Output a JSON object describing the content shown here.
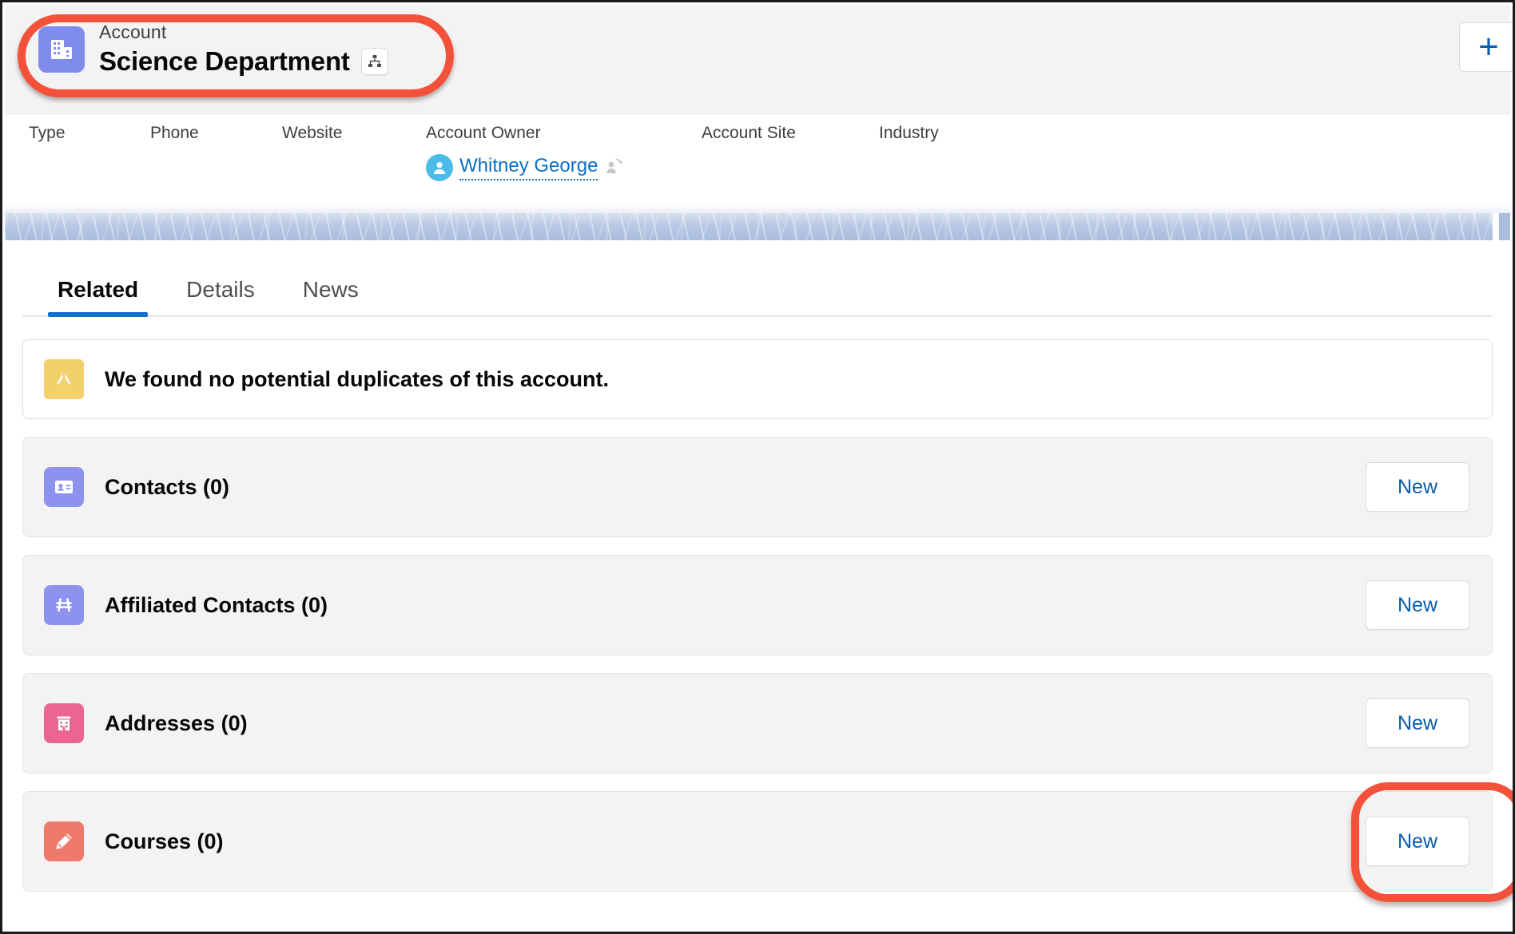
{
  "header": {
    "object_label": "Account",
    "record_name": "Science Department",
    "hierarchy_icon": "hierarchy-icon",
    "object_icon": "account-building-icon",
    "add_button_label": "+",
    "add_button_icon": "plus-icon"
  },
  "highlight_fields": [
    {
      "label": "Type",
      "value": ""
    },
    {
      "label": "Phone",
      "value": ""
    },
    {
      "label": "Website",
      "value": ""
    },
    {
      "label": "Account Owner",
      "value": "Whitney George",
      "avatar_icon": "user-avatar-icon",
      "action_icon": "change-owner-icon"
    },
    {
      "label": "Account Site",
      "value": ""
    },
    {
      "label": "Industry",
      "value": ""
    }
  ],
  "tabs": [
    {
      "label": "Related",
      "active": true
    },
    {
      "label": "Details",
      "active": false
    },
    {
      "label": "News",
      "active": false
    }
  ],
  "duplicate_banner": {
    "icon": "duplicate-check-icon",
    "message": "We found no potential duplicates of this account."
  },
  "related_lists": [
    {
      "title": "Contacts (0)",
      "icon": "contact-card-icon",
      "icon_color": "#8e92ef",
      "action_label": "New",
      "highlighted": false
    },
    {
      "title": "Affiliated Contacts (0)",
      "icon": "affiliation-icon",
      "icon_color": "#8e92ef",
      "action_label": "New",
      "highlighted": false
    },
    {
      "title": "Addresses (0)",
      "icon": "address-building-icon",
      "icon_color": "#ea6593",
      "action_label": "New",
      "highlighted": false
    },
    {
      "title": "Courses (0)",
      "icon": "course-pencil-icon",
      "icon_color": "#ed7a6a",
      "action_label": "New",
      "highlighted": true
    }
  ],
  "annotations": [
    {
      "name": "header-callout",
      "color": "#f4513b",
      "shape": "oval"
    },
    {
      "name": "new-button-callout",
      "color": "#f4513b",
      "shape": "oval"
    }
  ],
  "colors": {
    "accent_link": "#0b5cab",
    "owner_link": "#0b6fc4",
    "tab_underline": "#1072cd",
    "annotation": "#f4513b",
    "band": "#aabddd"
  }
}
